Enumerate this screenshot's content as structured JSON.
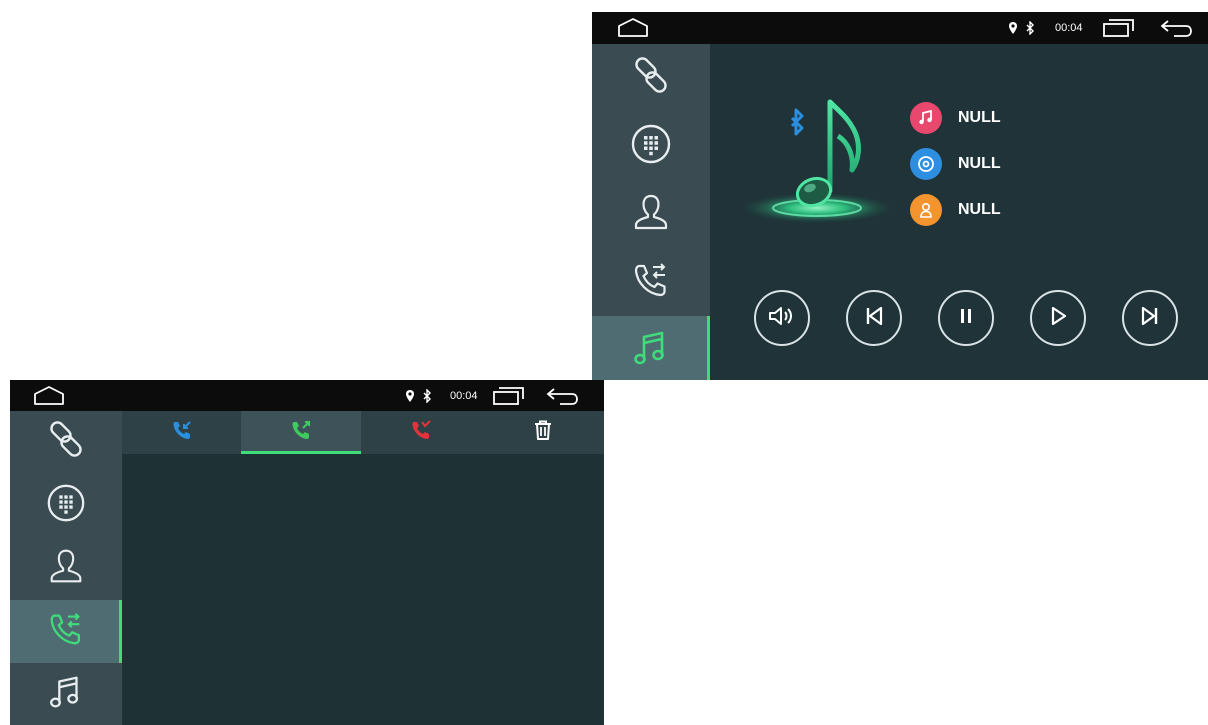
{
  "music_screen": {
    "status_bar": {
      "home_icon": "home-outline-icon",
      "location_icon": "location-pin-icon",
      "bluetooth_icon": "bluetooth-icon",
      "time": "00:04",
      "recent_icon": "recent-apps-icon",
      "back_icon": "back-arrow-icon"
    },
    "sidebar": {
      "items": [
        {
          "name": "link",
          "icon": "link-icon",
          "active": false
        },
        {
          "name": "dialpad",
          "icon": "dialpad-icon",
          "active": false
        },
        {
          "name": "contacts",
          "icon": "person-icon",
          "active": false
        },
        {
          "name": "call-log",
          "icon": "call-log-icon",
          "active": false
        },
        {
          "name": "music",
          "icon": "music-note-icon",
          "active": true
        }
      ]
    },
    "artwork": {
      "icon": "bluetooth-music-note-icon",
      "glow_color": "#2fd68a"
    },
    "track_info": {
      "title": "NULL",
      "album": "NULL",
      "artist": "NULL",
      "title_icon": "music-note-icon",
      "album_icon": "album-disc-icon",
      "artist_icon": "artist-person-icon"
    },
    "controls": [
      {
        "name": "volume",
        "icon": "volume-icon"
      },
      {
        "name": "previous",
        "icon": "skip-previous-icon"
      },
      {
        "name": "pause",
        "icon": "pause-icon"
      },
      {
        "name": "play",
        "icon": "play-icon"
      },
      {
        "name": "next",
        "icon": "skip-next-icon"
      }
    ]
  },
  "calllog_screen": {
    "status_bar": {
      "home_icon": "home-outline-icon",
      "location_icon": "location-pin-icon",
      "bluetooth_icon": "bluetooth-icon",
      "time": "00:04",
      "recent_icon": "recent-apps-icon",
      "back_icon": "back-arrow-icon"
    },
    "sidebar": {
      "items": [
        {
          "name": "link",
          "icon": "link-icon",
          "active": false
        },
        {
          "name": "dialpad",
          "icon": "dialpad-icon",
          "active": false
        },
        {
          "name": "contacts",
          "icon": "person-icon",
          "active": false
        },
        {
          "name": "call-log",
          "icon": "call-log-icon",
          "active": true
        },
        {
          "name": "music",
          "icon": "music-note-icon",
          "active": false
        }
      ]
    },
    "tabs": [
      {
        "name": "incoming",
        "icon": "incoming-call-icon",
        "color": "#2b8fe0",
        "active": false
      },
      {
        "name": "outgoing",
        "icon": "outgoing-call-icon",
        "color": "#3fc95e",
        "active": true
      },
      {
        "name": "missed",
        "icon": "missed-call-icon",
        "color": "#e0363b",
        "active": false
      },
      {
        "name": "delete",
        "icon": "trash-icon",
        "color": "#ffffff",
        "active": false
      }
    ]
  },
  "colors": {
    "accent": "#3fdc7a",
    "background": "#1f3338",
    "sidebar": "#3a4c51",
    "status_bar": "#0c0c0c",
    "track_title_icon": "#e8476e",
    "track_album_icon": "#2e8fe0",
    "track_artist_icon": "#f3942e"
  }
}
